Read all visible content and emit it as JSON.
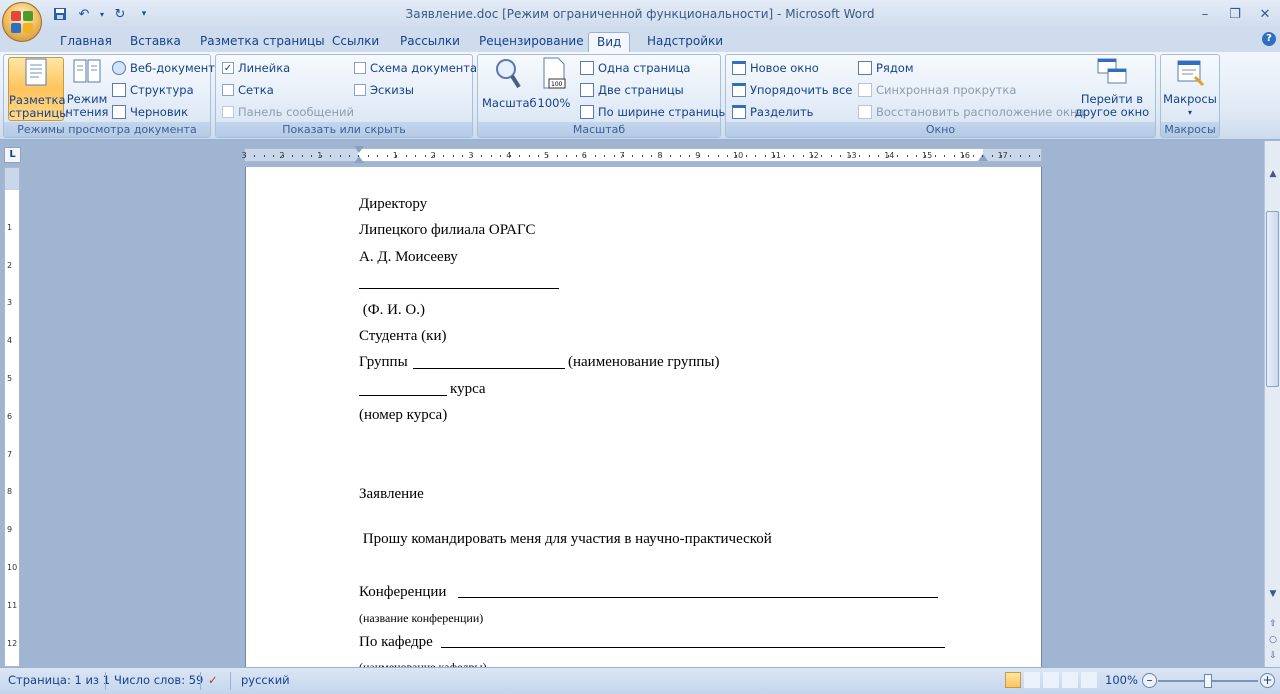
{
  "window": {
    "title": "Заявление.doc [Режим ограниченной функциональности] - Microsoft Word"
  },
  "tabs": [
    {
      "label": "Главная"
    },
    {
      "label": "Вставка"
    },
    {
      "label": "Разметка страницы"
    },
    {
      "label": "Ссылки"
    },
    {
      "label": "Рассылки"
    },
    {
      "label": "Рецензирование"
    },
    {
      "label": "Вид"
    },
    {
      "label": "Надстройки"
    }
  ],
  "ribbon": {
    "views": {
      "label": "Режимы просмотра документа",
      "print_layout_l1": "Разметка",
      "print_layout_l2": "страницы",
      "reading_l1": "Режим",
      "reading_l2": "чтения",
      "web": "Веб-документ",
      "outline": "Структура",
      "draft": "Черновик"
    },
    "show_hide": {
      "label": "Показать или скрыть",
      "ruler": "Линейка",
      "gridlines": "Сетка",
      "message_bar": "Панель сообщений",
      "doc_map": "Схема документа",
      "thumbnails": "Эскизы"
    },
    "zoom": {
      "label": "Масштаб",
      "zoom_btn": "Масштаб",
      "hundred": "100%",
      "one_page": "Одна страница",
      "two_pages": "Две страницы",
      "page_width": "По ширине страницы"
    },
    "window": {
      "label": "Окно",
      "new_window": "Новое окно",
      "arrange_all": "Упорядочить все",
      "split": "Разделить",
      "side_by_side": "Рядом",
      "sync_scroll": "Синхронная прокрутка",
      "reset_position": "Восстановить расположение окна",
      "switch_l1": "Перейти в",
      "switch_l2": "другое окно"
    },
    "macros": {
      "label": "Макросы",
      "macros_btn": "Макросы"
    }
  },
  "ruler": {
    "ticks": [
      "3",
      "2",
      "1",
      "1",
      "2",
      "3",
      "4",
      "5",
      "6",
      "7",
      "8",
      "9",
      "10",
      "11",
      "12",
      "13",
      "14",
      "15",
      "16",
      "17"
    ]
  },
  "vruler": {
    "ticks": [
      "1",
      "2",
      "3",
      "4",
      "5",
      "6",
      "7",
      "8",
      "9",
      "10",
      "11",
      "12"
    ]
  },
  "document": {
    "lines": [
      "Директору",
      "Липецкого филиала ОРАГС",
      "А. Д. Моисееву",
      " (Ф. И. О.)",
      "Студента (ки)",
      "Группы",
      "(наименование группы)",
      "курса",
      "(номер курса)",
      "Заявление",
      " Прошу командировать меня для участия в научно-практической",
      "Конференции",
      "(название конференции)",
      "По кафедре",
      "(наименование кафедры)"
    ]
  },
  "status": {
    "page": "Страница: 1 из 1",
    "words": "Число слов: 59",
    "language": "русский",
    "zoom": "100%",
    "zoom_level": 0.5
  }
}
